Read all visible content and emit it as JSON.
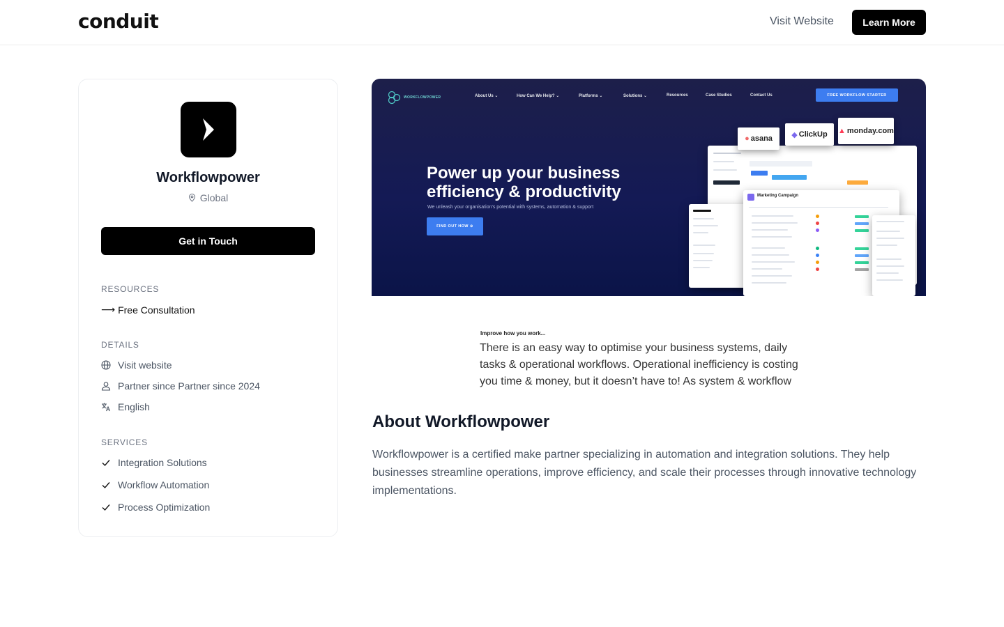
{
  "header": {
    "logo": "conduit",
    "visit_link": "Visit Website",
    "learn_button": "Learn More"
  },
  "partner": {
    "name": "Workflowpower",
    "location": "Global",
    "cta": "Get in Touch"
  },
  "resources": {
    "title": "RESOURCES",
    "link": "Free Consultation"
  },
  "details": {
    "title": "DETAILS",
    "website": "Visit website",
    "partner_since": "Partner since Partner since 2024",
    "language": "English"
  },
  "services": {
    "title": "SERVICES",
    "items": [
      "Integration Solutions",
      "Workflow Automation",
      "Process Optimization"
    ]
  },
  "hero": {
    "brand": "WORKFLOWPOWER",
    "nav": [
      "About Us ⌄",
      "How Can We Help? ⌄",
      "Platforms ⌄",
      "Solutions ⌄",
      "Resources",
      "Case Studies",
      "Contact Us"
    ],
    "cta": "FREE WORKFLOW STARTER",
    "headline": "Power up your business efficiency & productivity",
    "subline": "We unleash your organisation's potential with systems, automation & support",
    "button": "FIND OUT HOW ⊕",
    "brands": [
      "asana",
      "ClickUp",
      "monday.com"
    ],
    "mock_title": "Marketing Campaign"
  },
  "excerpt": {
    "label": "Improve how you work...",
    "text": "There is an easy way to optimise your business systems, daily tasks & operational workflows. Operational inefficiency is costing you time & money, but it doesn’t have to! As system & workflow"
  },
  "about": {
    "title": "About Workflowpower",
    "body": "Workflowpower is a certified make partner specializing in automation and integration solutions. They help businesses streamline operations, improve efficiency, and scale their processes through innovative technology implementations."
  },
  "colors": {
    "primary": "#000000",
    "hero_bg": "#141a55",
    "hero_accent": "#3d7df0"
  }
}
